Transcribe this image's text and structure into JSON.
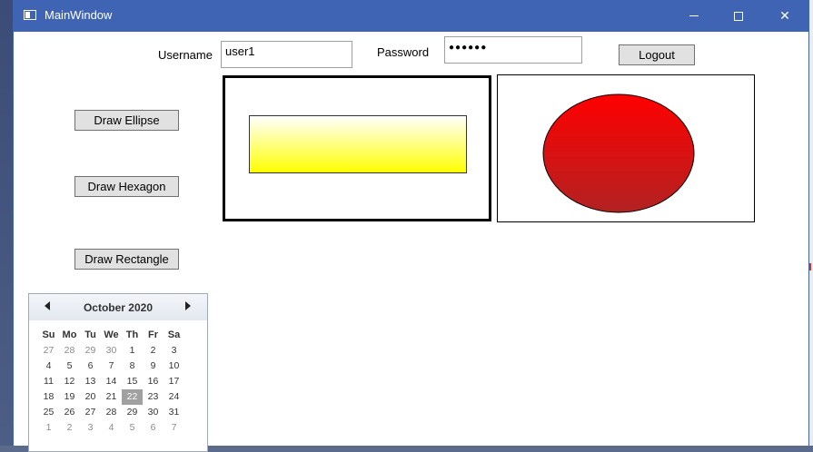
{
  "window": {
    "title": "MainWindow",
    "minimize": "—",
    "close": "✕"
  },
  "login": {
    "username_label": "Username",
    "username_value": "user1",
    "password_label": "Password",
    "password_value": "●●●●●●",
    "logout_label": "Logout"
  },
  "buttons": {
    "draw_ellipse": "Draw Ellipse",
    "draw_hexagon": "Draw Hexagon",
    "draw_rectangle": "Draw Rectangle"
  },
  "shapes": {
    "rectangle_gradient": [
      "#ffffff",
      "#ffff00"
    ],
    "ellipse_gradient": [
      "#ff0000",
      "#b22222"
    ]
  },
  "calendar": {
    "month": "October 2020",
    "days_of_week": [
      "Su",
      "Mo",
      "Tu",
      "We",
      "Th",
      "Fr",
      "Sa"
    ],
    "weeks": [
      [
        "27",
        "28",
        "29",
        "30",
        "1",
        "2",
        "3"
      ],
      [
        "4",
        "5",
        "6",
        "7",
        "8",
        "9",
        "10"
      ],
      [
        "11",
        "12",
        "13",
        "14",
        "15",
        "16",
        "17"
      ],
      [
        "18",
        "19",
        "20",
        "21",
        "22",
        "23",
        "24"
      ],
      [
        "25",
        "26",
        "27",
        "28",
        "29",
        "30",
        "31"
      ],
      [
        "1",
        "2",
        "3",
        "4",
        "5",
        "6",
        "7"
      ]
    ],
    "today": "22"
  }
}
